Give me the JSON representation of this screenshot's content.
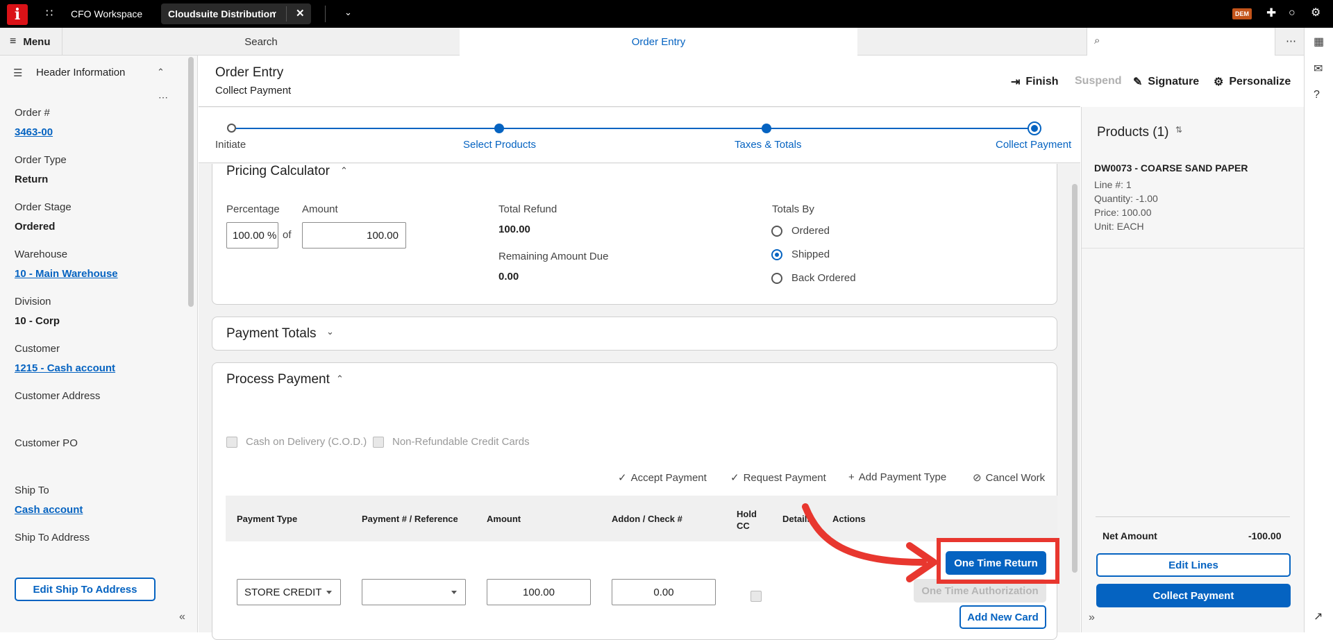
{
  "topbar": {
    "logo": "i",
    "workspace": "CFO Workspace",
    "active_tab": "Cloudsuite Distribution",
    "badge": "DEM"
  },
  "subbar": {
    "menu": "Menu",
    "search_tab": "Search",
    "order_tab": "Order Entry"
  },
  "left": {
    "section_title": "Header Information",
    "fields": [
      {
        "label": "Order #",
        "value": "3463-00"
      },
      {
        "label": "Order Type",
        "value": "Return"
      },
      {
        "label": "Order Stage",
        "value": "Ordered"
      },
      {
        "label": "Warehouse",
        "value": "10 - Main Warehouse"
      },
      {
        "label": "Division",
        "value": "10 - Corp"
      },
      {
        "label": "Customer",
        "value": "1215 - Cash account"
      },
      {
        "label": "Customer Address",
        "value": ""
      },
      {
        "label": "Customer PO",
        "value": ""
      },
      {
        "label": "Ship To",
        "value": "Cash account"
      },
      {
        "label": "Ship To Address",
        "value": ""
      }
    ],
    "edit_ship_to": "Edit Ship To Address"
  },
  "header": {
    "title": "Order Entry",
    "subtitle": "Collect Payment",
    "finish": "Finish",
    "suspend": "Suspend",
    "signature": "Signature",
    "personalize": "Personalize"
  },
  "steps": [
    "Initiate",
    "Select Products",
    "Taxes & Totals",
    "Collect Payment"
  ],
  "pricing": {
    "title": "Pricing Calculator",
    "percentage_label": "Percentage",
    "percentage_value": "100.00 %",
    "of": "of",
    "amount_label": "Amount",
    "amount_value": "100.00",
    "total_refund_label": "Total Refund",
    "total_refund_value": "100.00",
    "remaining_label": "Remaining Amount Due",
    "remaining_value": "0.00",
    "totals_by_label": "Totals By",
    "options": [
      "Ordered",
      "Shipped",
      "Back Ordered"
    ],
    "selected": "Shipped"
  },
  "payment_totals": {
    "title": "Payment Totals"
  },
  "process": {
    "title": "Process Payment",
    "cod": "Cash on Delivery (C.O.D.)",
    "nonref": "Non-Refundable Credit Cards",
    "accept": "Accept Payment",
    "request": "Request Payment",
    "add_type": "Add Payment Type",
    "cancel": "Cancel Work",
    "columns": [
      "Payment Type",
      "Payment # / Reference",
      "Amount",
      "Addon / Check #",
      "Hold CC",
      "Details",
      "Actions"
    ],
    "row": {
      "payment_type": "STORE CREDIT",
      "reference": "",
      "amount": "100.00",
      "addon": "0.00"
    },
    "one_time_return": "One Time Return",
    "one_time_auth": "One Time Authorization",
    "add_new_card": "Add New Card"
  },
  "products": {
    "title": "Products (1)",
    "item_name": "DW0073 - COARSE SAND PAPER",
    "line": "Line #: 1",
    "quantity": "Quantity: -1.00",
    "price": "Price: 100.00",
    "unit": "Unit: EACH",
    "net_label": "Net Amount",
    "net_value": "-100.00",
    "edit_lines": "Edit Lines",
    "collect_payment": "Collect Payment"
  }
}
